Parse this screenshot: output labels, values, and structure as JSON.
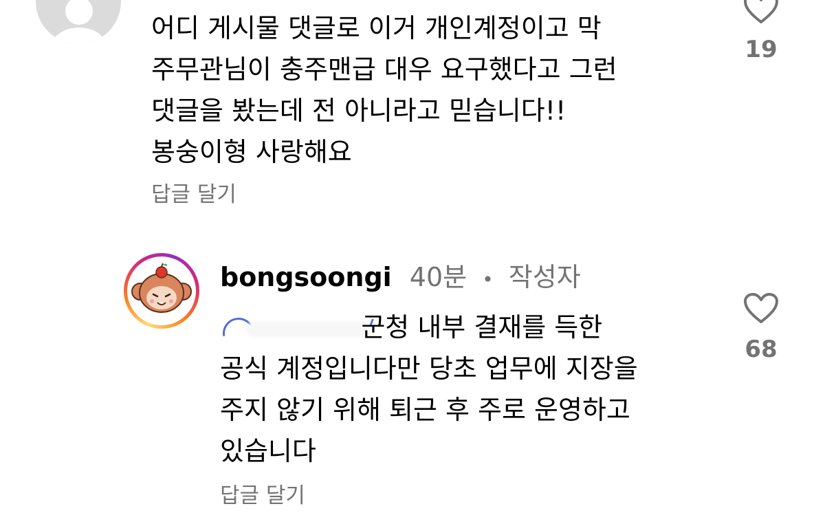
{
  "comments": [
    {
      "text": "어디 게시물 댓글로 이거 개인계정이고 막\n주무관님이 충주맨급 대우 요구했다고 그런\n댓글을 봤는데 전 아니라고 믿습니다!!\n봉숭이형 사랑해요",
      "reply_label": "답글 달기",
      "like_count": "19",
      "avatar_icon": "default-avatar-icon"
    },
    {
      "username": "bongsoongi",
      "time": "40분",
      "separator": "•",
      "author_badge": "작성자",
      "mention": "",
      "text": "                 군청 내부 결재를 득한\n공식 계정입니다만 당초 업무에 지장을\n주지 않기 위해 퇴근 후 주로 운영하고\n있습니다",
      "reply_label": "답글 달기",
      "like_count": "68",
      "avatar_icon": "monkey-avatar-icon"
    }
  ],
  "colors": {
    "secondary_text": "#737373",
    "mention_blue": "#4f6fd6",
    "story_ring_start": "#feda75",
    "story_ring_end": "#d62976"
  }
}
